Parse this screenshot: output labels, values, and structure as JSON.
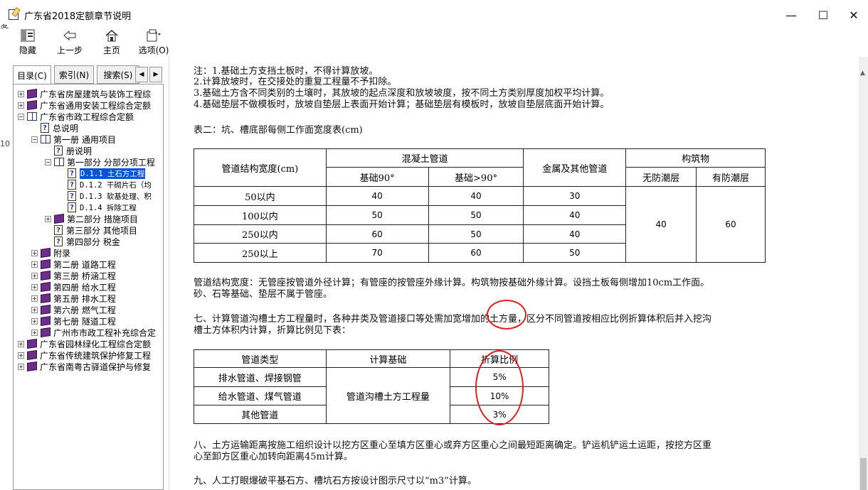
{
  "window": {
    "title": "广东省2018定额章节说明",
    "minimize": "—",
    "maximize": "☐",
    "close": "✕",
    "left_clip_text": "条",
    "left_clip_text2": "10"
  },
  "toolbar": {
    "hide": "隐藏",
    "back": "上一步",
    "home": "主页",
    "options": "选项(O)"
  },
  "tabs": {
    "contents": "目录(C)",
    "index": "索引(N)",
    "search": "搜索(S)",
    "prev": "◀",
    "next": "▶"
  },
  "tree": [
    {
      "level": 0,
      "exp": "+",
      "icon": "book-closed",
      "text": "广东省房屋建筑与装饰工程综"
    },
    {
      "level": 0,
      "exp": "+",
      "icon": "book-closed",
      "text": "广东省通用安装工程综合定额"
    },
    {
      "level": 0,
      "exp": "−",
      "icon": "book-open",
      "text": "广东省市政工程综合定额"
    },
    {
      "level": 1,
      "exp": "",
      "icon": "page",
      "text": "总说明"
    },
    {
      "level": 1,
      "exp": "−",
      "icon": "book-open",
      "text": "第一册 通用项目"
    },
    {
      "level": 2,
      "exp": "",
      "icon": "page",
      "text": "册说明"
    },
    {
      "level": 2,
      "exp": "−",
      "icon": "book-open",
      "text": "第一部分 分部分项工程"
    },
    {
      "level": 3,
      "exp": "",
      "icon": "page",
      "text": "D.1.1 土石方工程",
      "mono": true,
      "selected": true
    },
    {
      "level": 3,
      "exp": "",
      "icon": "page",
      "text": "D.1.2 干砌片石（均",
      "mono": true
    },
    {
      "level": 3,
      "exp": "",
      "icon": "page",
      "text": "D.1.3 软基处理、积",
      "mono": true
    },
    {
      "level": 3,
      "exp": "",
      "icon": "page",
      "text": "D.1.4 拆除工程",
      "mono": true
    },
    {
      "level": 2,
      "exp": "+",
      "icon": "book-closed",
      "text": "第二部分 措施项目"
    },
    {
      "level": 2,
      "exp": "",
      "icon": "page",
      "text": "第三部分 其他项目"
    },
    {
      "level": 2,
      "exp": "",
      "icon": "page",
      "text": "第四部分 税金"
    },
    {
      "level": 1,
      "exp": "+",
      "icon": "book-closed",
      "text": "附录"
    },
    {
      "level": 1,
      "exp": "+",
      "icon": "book-closed",
      "text": "第二册 道路工程"
    },
    {
      "level": 1,
      "exp": "+",
      "icon": "book-closed",
      "text": "第三册 桥涵工程"
    },
    {
      "level": 1,
      "exp": "+",
      "icon": "book-closed",
      "text": "第四册 给水工程"
    },
    {
      "level": 1,
      "exp": "+",
      "icon": "book-closed",
      "text": "第五册 排水工程"
    },
    {
      "level": 1,
      "exp": "+",
      "icon": "book-closed",
      "text": "第六册 燃气工程"
    },
    {
      "level": 1,
      "exp": "+",
      "icon": "book-closed",
      "text": "第七册 隧道工程"
    },
    {
      "level": 1,
      "exp": "+",
      "icon": "book-closed",
      "text": "广州市市政工程补充综合定"
    },
    {
      "level": 0,
      "exp": "+",
      "icon": "book-closed",
      "text": "广东省园林绿化工程综合定额"
    },
    {
      "level": 0,
      "exp": "+",
      "icon": "book-closed",
      "text": "广东省传统建筑保护修复工程"
    },
    {
      "level": 0,
      "exp": "+",
      "icon": "book-closed",
      "text": "广东省南粤古驿道保护与修复"
    }
  ],
  "content": {
    "notes": [
      "注：1.基础土方支挡土板时，不得计算放坡。",
      "2.计算放坡时，在交接处的重复工程量不予扣除。",
      "3.基础土方含不同类别的土壤时，其放坡的起点深度和放坡坡度，按不同土方类别厚度加权平均计算。",
      "4.基础垫层不做模板时，放坡自垫层上表面开始计算；基础垫层有模板时，放坡自垫层底面开始计算。"
    ],
    "table2_title": "表二：坑、槽底部每侧工作面宽度表(cm)",
    "table2": {
      "h_width": "管道结构宽度(cm)",
      "h_concrete": "混凝土管道",
      "h_base90": "基础90°",
      "h_base_gt90": "基础>90°",
      "h_metal": "金属及其他管道",
      "h_structure": "构筑物",
      "h_no_moisture": "无防潮层",
      "h_moisture": "有防潮层",
      "rows": [
        {
          "w": "50以内",
          "a": "40",
          "b": "40",
          "c": "30"
        },
        {
          "w": "100以内",
          "a": "50",
          "b": "50",
          "c": "40"
        },
        {
          "w": "250以内",
          "a": "60",
          "b": "50",
          "c": "40"
        },
        {
          "w": "250以上",
          "a": "70",
          "b": "60",
          "c": "50"
        }
      ],
      "struct_no": "40",
      "struct_yes": "60"
    },
    "para_width": [
      "管道结构宽度：无管座按管道外径计算；有管座的按管座外缘计算。构筑物按基础外缘计算。设挡土板每侧增加10cm工作面。",
      "砂、石等基础、垫层不属于管座。"
    ],
    "para7": [
      "七、计算管道沟槽土方工程量时，各种井类及管道接口等处需加宽增加的土方量，区分不同管道按相应比例折算体积后并入挖沟",
      "槽土方体积内计算，折算比例见下表："
    ],
    "table3": {
      "h_type": "管道类型",
      "h_basis": "计算基础",
      "h_ratio": "折算比例",
      "basis": "管道沟槽土方工程量",
      "rows": [
        {
          "type": "排水管道、焊接钢管",
          "ratio": "5%"
        },
        {
          "type": "给水管道、煤气管道",
          "ratio": "10%"
        },
        {
          "type": "其他管道",
          "ratio": "3%"
        }
      ]
    },
    "para8": [
      "八、土方运输距离按施工组织设计以挖方区重心至填方区重心或弃方区重心之间最短距离确定。铲运机铲运土运距，按挖方区重",
      "心至卸方区重心加转向距离45m计算。"
    ],
    "para9": "九、人工打眼爆破平基石方、槽坑石方按设计图示尺寸以“m3”计算。"
  },
  "colors": {
    "selection": "#0a52d6",
    "annotation": "#e02020",
    "book": "#6b2f8a"
  }
}
